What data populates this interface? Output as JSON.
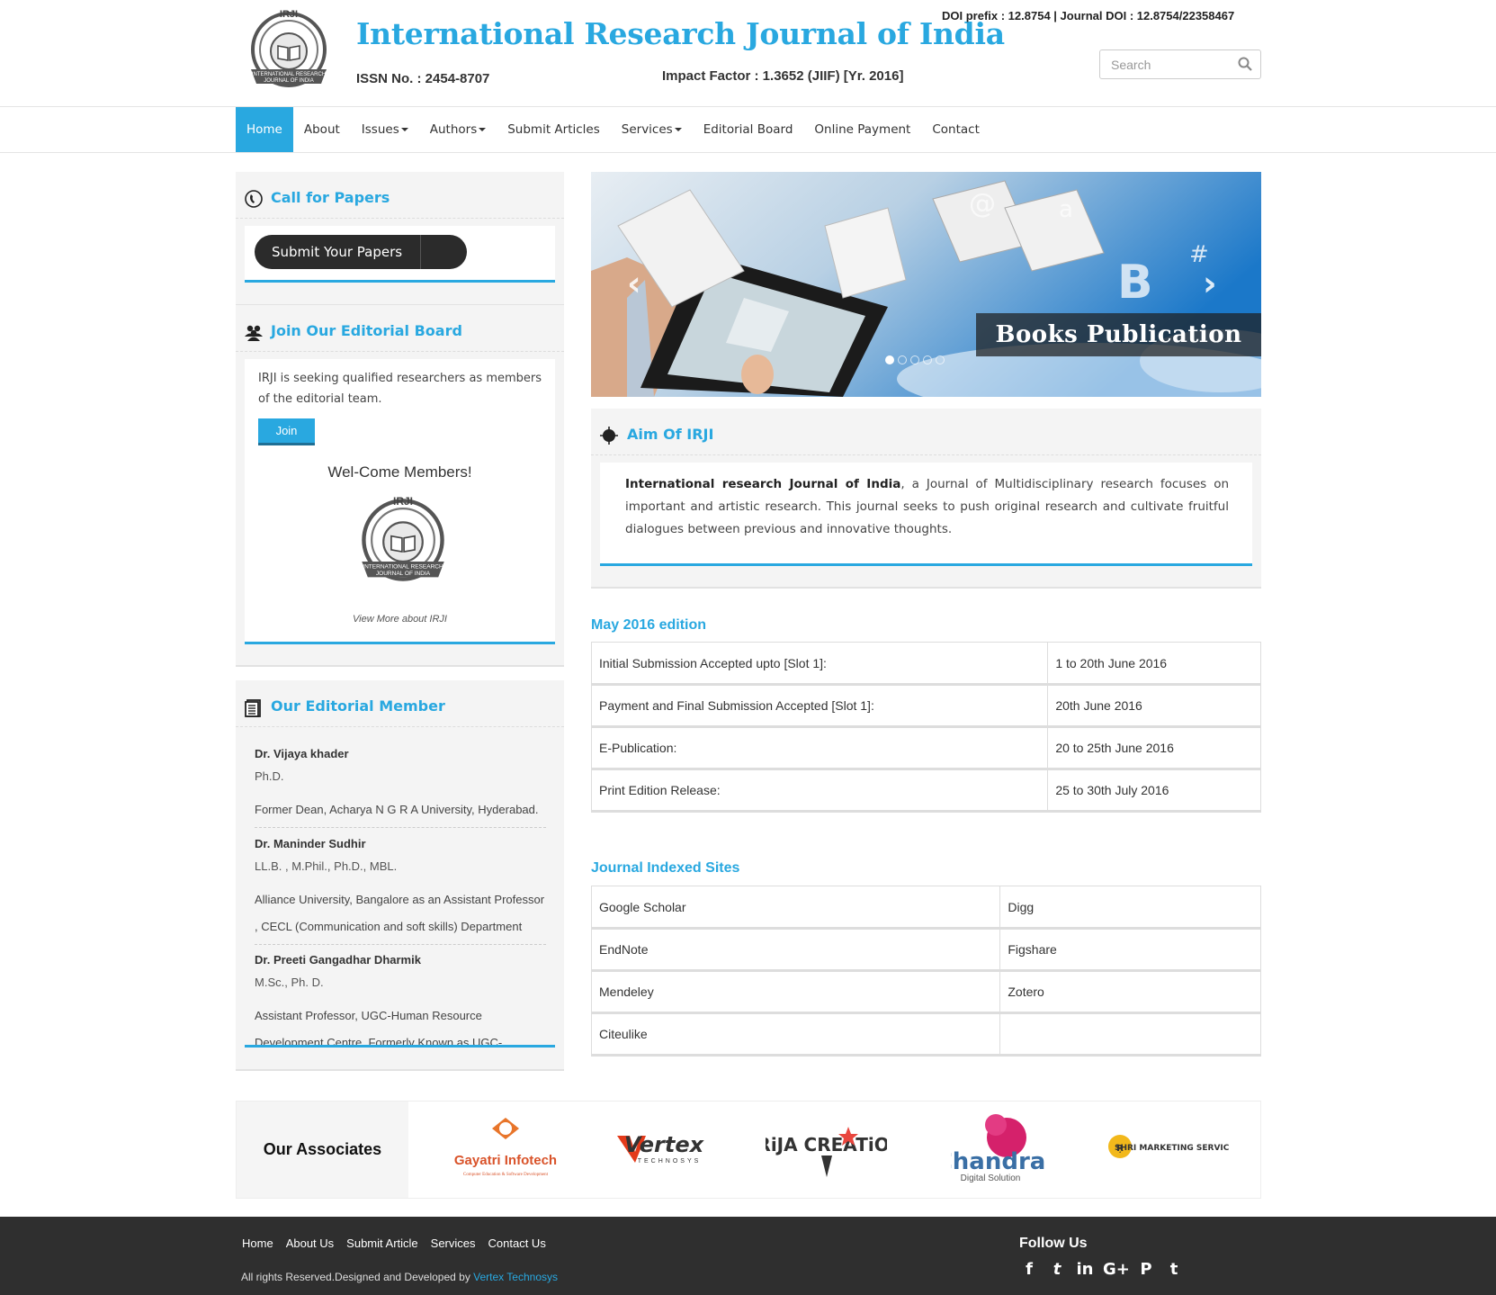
{
  "header": {
    "title": "International Research Journal of India",
    "issn": "ISSN No. : 2454-8707",
    "impact_factor": "Impact Factor : 1.3652 (JIIF) [Yr. 2016]",
    "doi": "DOI prefix : 12.8754 | Journal DOI : 12.8754/22358467",
    "search_placeholder": "Search",
    "logo_text_top": "IRJI",
    "logo_text_bottom1": "INTERNATIONAL RESEARCH",
    "logo_text_bottom2": "JOURNAL OF INDIA"
  },
  "nav": {
    "items": [
      {
        "label": "Home",
        "active": true
      },
      {
        "label": "About"
      },
      {
        "label": "Issues",
        "dropdown": true
      },
      {
        "label": "Authors",
        "dropdown": true
      },
      {
        "label": "Submit Articles"
      },
      {
        "label": "Services",
        "dropdown": true
      },
      {
        "label": "Editorial Board"
      },
      {
        "label": "Online Payment"
      },
      {
        "label": "Contact"
      }
    ]
  },
  "sidebar": {
    "call_for_papers": {
      "title": "Call for Papers",
      "button": "Submit Your Papers"
    },
    "editorial_board": {
      "title": "Join Our Editorial Board",
      "text": "IRJI is seeking qualified researchers as members of the editorial team.",
      "join": "Join",
      "welcome": "Wel-Come Members!",
      "view_more": "View More about IRJI"
    },
    "members": {
      "title": "Our Editorial Member",
      "list": [
        {
          "name": "Dr. Vijaya khader",
          "degree": "Ph.D.",
          "affiliation": "Former Dean, Acharya N G R A University, Hyderabad."
        },
        {
          "name": "Dr. Maninder Sudhir",
          "degree": "LL.B. , M.Phil., Ph.D., MBL.",
          "affiliation": "Alliance University, Bangalore as an Assistant Professor , CECL (Communication and soft skills) Department"
        },
        {
          "name": "Dr. Preeti Gangadhar Dharmik",
          "degree": "M.Sc., Ph. D.",
          "affiliation": "Assistant Professor, UGC-Human Resource Development Centre, Formerly Known as UGC-Academic Staff"
        }
      ]
    }
  },
  "banner": {
    "caption": "Books Publication",
    "prev": "‹",
    "next": "›",
    "slides": 5,
    "active_slide": 1
  },
  "aim": {
    "title": "Aim Of IRJI",
    "bold": "International research Journal of India",
    "text": ", a Journal of Multidisciplinary research focuses on important and artistic research. This journal seeks to push original research and cultivate fruitful dialogues between previous and innovative thoughts."
  },
  "edition": {
    "title": "May 2016 edition",
    "rows": [
      [
        "Initial Submission Accepted upto [Slot 1]:",
        "1 to 20th June 2016"
      ],
      [
        "Payment and Final Submission Accepted [Slot 1]:",
        "20th June 2016"
      ],
      [
        "E-Publication:",
        "20 to 25th June 2016"
      ],
      [
        "Print Edition Release:",
        "25 to 30th July 2016"
      ]
    ]
  },
  "indexed": {
    "title": "Journal Indexed Sites",
    "rows": [
      [
        "Google Scholar",
        "Digg"
      ],
      [
        "EndNote",
        "Figshare"
      ],
      [
        "Mendeley",
        "Zotero"
      ],
      [
        "Citeulike",
        ""
      ]
    ]
  },
  "associates": {
    "title": "Our Associates",
    "logos": [
      {
        "name": "Gayatri Infotech",
        "sub": "Computer Education & Software Development"
      },
      {
        "name": "Vertex",
        "sub": "TECHNOSYS"
      },
      {
        "name": "GiRiJA CREATiONS"
      },
      {
        "name": "Chandra",
        "sub": "Digital Solution"
      },
      {
        "name": "SHRI MARKETING SERVICES"
      }
    ]
  },
  "footer": {
    "links": [
      "Home",
      "About Us",
      "Submit Article",
      "Services",
      "Contact Us"
    ],
    "copyright": "All rights Reserved.Designed and Developed by ",
    "developer": "Vertex Technosys",
    "follow": "Follow Us",
    "socials": [
      {
        "icon": "facebook-icon",
        "glyph": "f"
      },
      {
        "icon": "twitter-icon",
        "glyph": "t"
      },
      {
        "icon": "linkedin-icon",
        "glyph": "in"
      },
      {
        "icon": "google-plus-icon",
        "glyph": "G+"
      },
      {
        "icon": "pinterest-icon",
        "glyph": "P"
      },
      {
        "icon": "tumblr-icon",
        "glyph": "t"
      }
    ]
  },
  "colors": {
    "accent": "#29a8e0",
    "dark": "#2f2f2f",
    "panel": "#f4f4f4"
  }
}
